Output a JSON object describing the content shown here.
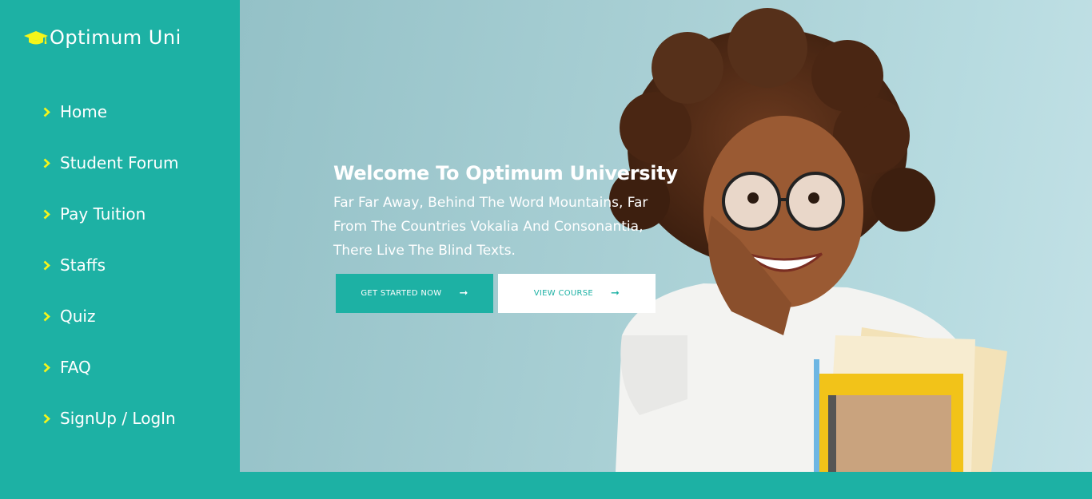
{
  "brand": {
    "name": "Optimum Uni",
    "icon": "graduation-cap-icon"
  },
  "nav": {
    "items": [
      {
        "label": "Home",
        "icon": "chevron-right-icon"
      },
      {
        "label": "Student Forum",
        "icon": "chevron-right-icon"
      },
      {
        "label": "Pay Tuition",
        "icon": "chevron-right-icon"
      },
      {
        "label": "Staffs",
        "icon": "chevron-right-icon"
      },
      {
        "label": "Quiz",
        "icon": "chevron-right-icon"
      },
      {
        "label": "FAQ",
        "icon": "chevron-right-icon"
      },
      {
        "label": "SignUp / LogIn",
        "icon": "chevron-right-icon"
      }
    ]
  },
  "hero": {
    "title": "Welcome To Optimum University",
    "subtitle": "Far Far Away, Behind The Word Mountains, Far From The Countries Vokalia And Consonantia, There Live The Blind Texts.",
    "primary_button": "GET STARTED NOW",
    "secondary_button": "VIEW COURSE",
    "button_icon": "arrow-right-icon"
  },
  "colors": {
    "accent": "#1db1a4",
    "chevron": "#f5f51a",
    "brand_icon": "#f5f51a",
    "text_light": "#ffffff"
  }
}
